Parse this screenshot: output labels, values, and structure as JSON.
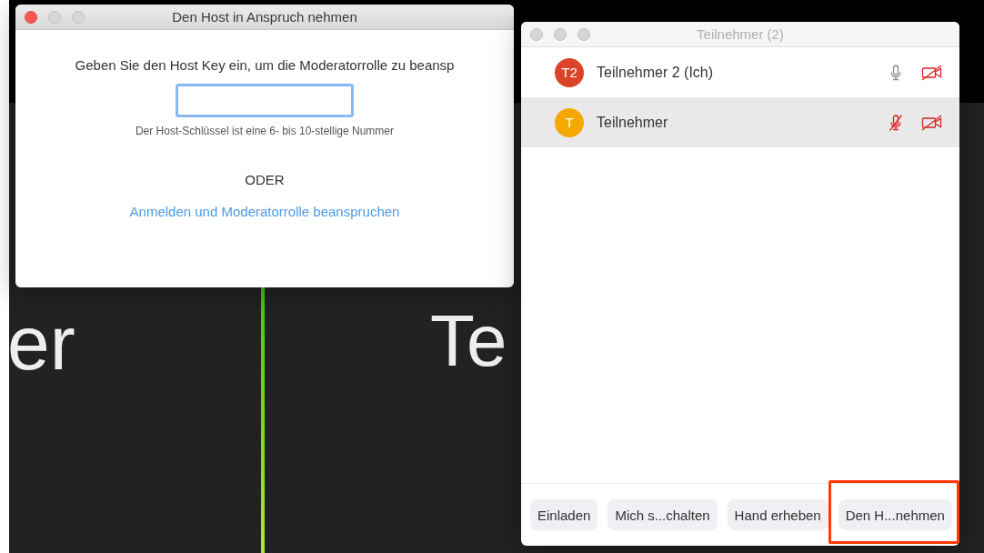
{
  "video_tiles": [
    {
      "label": "er",
      "active_speaker": true
    },
    {
      "label": "Te",
      "active_speaker": false
    }
  ],
  "host_dialog": {
    "title": "Den Host in Anspruch nehmen",
    "active": true,
    "prompt": "Geben Sie den Host Key ein, um die Moderatorrolle zu beansp",
    "hint": "Der Host-Schlüssel ist eine 6- bis 10-stellige Nummer",
    "separator": "ODER",
    "link": "Anmelden und Moderatorrolle beanspruchen"
  },
  "participants_window": {
    "title": "Teilnehmer (2)",
    "active": false,
    "participants": [
      {
        "initials": "T2",
        "color": "#d9442a",
        "name": "Teilnehmer 2 (Ich)",
        "mic_muted": false,
        "video_off": true,
        "selected": false
      },
      {
        "initials": "T",
        "color": "#f7a800",
        "name": "Teilnehmer",
        "mic_muted": true,
        "video_off": true,
        "selected": true
      }
    ],
    "buttons": [
      {
        "label": "Einladen",
        "highlighted": false
      },
      {
        "label": "Mich s...chalten",
        "highlighted": false
      },
      {
        "label": "Hand erheben",
        "highlighted": false
      },
      {
        "label": "Den H...nehmen",
        "highlighted": true
      }
    ]
  }
}
